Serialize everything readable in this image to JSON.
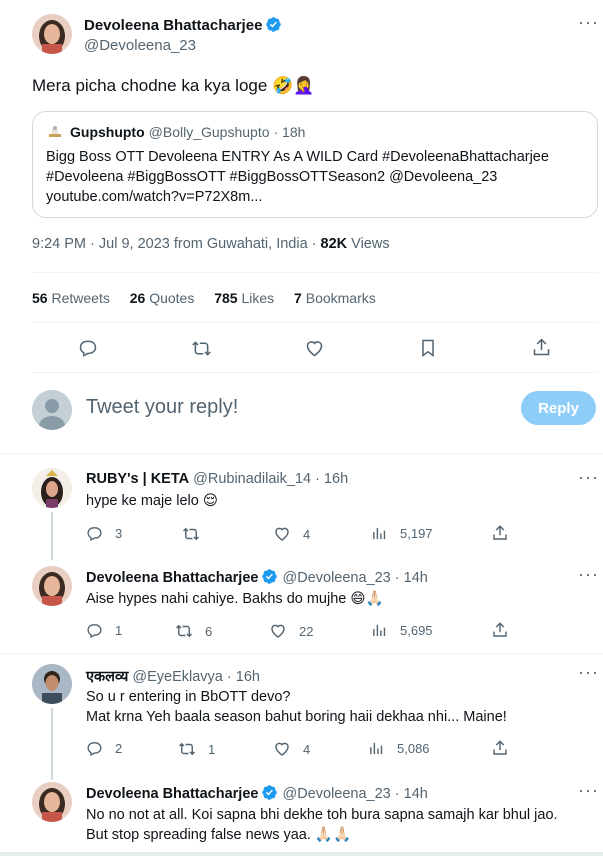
{
  "main_tweet": {
    "author_name": "Devoleena Bhattacharjee",
    "handle": "@Devoleena_23",
    "text": "Mera picha chodne ka kya loge 🤣🤦‍♀️",
    "quote": {
      "author_name": "Gupshupto",
      "handle": "@Bolly_Gupshupto",
      "time": "· 18h",
      "line1": "Bigg Boss OTT Devoleena ENTRY As A WILD Card #DevoleenaBhattacharjee",
      "line2": "#Devoleena #BiggBossOTT #BiggBossOTTSeason2 @Devoleena_23",
      "line3": "youtube.com/watch?v=P72X8m..."
    },
    "timestamp": "9:24 PM · Jul 9, 2023 from Guwahati, India ·",
    "views_count": "82K",
    "views_label": "Views",
    "stats": {
      "retweets_count": "56",
      "retweets_label": "Retweets",
      "quotes_count": "26",
      "quotes_label": "Quotes",
      "likes_count": "785",
      "likes_label": "Likes",
      "bookmarks_count": "7",
      "bookmarks_label": "Bookmarks"
    }
  },
  "composer": {
    "placeholder": "Tweet your reply!",
    "button_label": "Reply"
  },
  "replies": [
    {
      "author_name": "RUBY's | KETA",
      "handle": "@Rubinadilaik_14",
      "time": "· 16h",
      "text": "hype ke maje lelo 😌",
      "replies": "3",
      "retweets": "",
      "likes": "4",
      "views": "5,197"
    },
    {
      "author_name": "Devoleena Bhattacharjee",
      "handle": "@Devoleena_23",
      "time": "· 14h",
      "text": "Aise hypes nahi cahiye. Bakhs do mujhe 😄🙏🏻",
      "replies": "1",
      "retweets": "6",
      "likes": "22",
      "views": "5,695"
    },
    {
      "author_name": "एकलव्य",
      "handle": "@EyeEklavya",
      "time": "· 16h",
      "text_line1": "So u r entering in BbOTT devo?",
      "text_line2": "Mat krna Yeh baala season bahut boring haii dekhaa nhi... Maine!",
      "replies": "2",
      "retweets": "1",
      "likes": "4",
      "views": "5,086"
    },
    {
      "author_name": "Devoleena Bhattacharjee",
      "handle": "@Devoleena_23",
      "time": "· 14h",
      "text_line1": "No no not at all. Koi sapna bhi dekhe toh bura sapna samajh kar bhul jao.",
      "text_line2": "But stop spreading false news yaa. 🙏🏻🙏🏻"
    }
  ],
  "colors": {
    "accent": "#1d9bf0",
    "reply_button_bg": "#8ecdf8",
    "muted_text": "#536471"
  }
}
